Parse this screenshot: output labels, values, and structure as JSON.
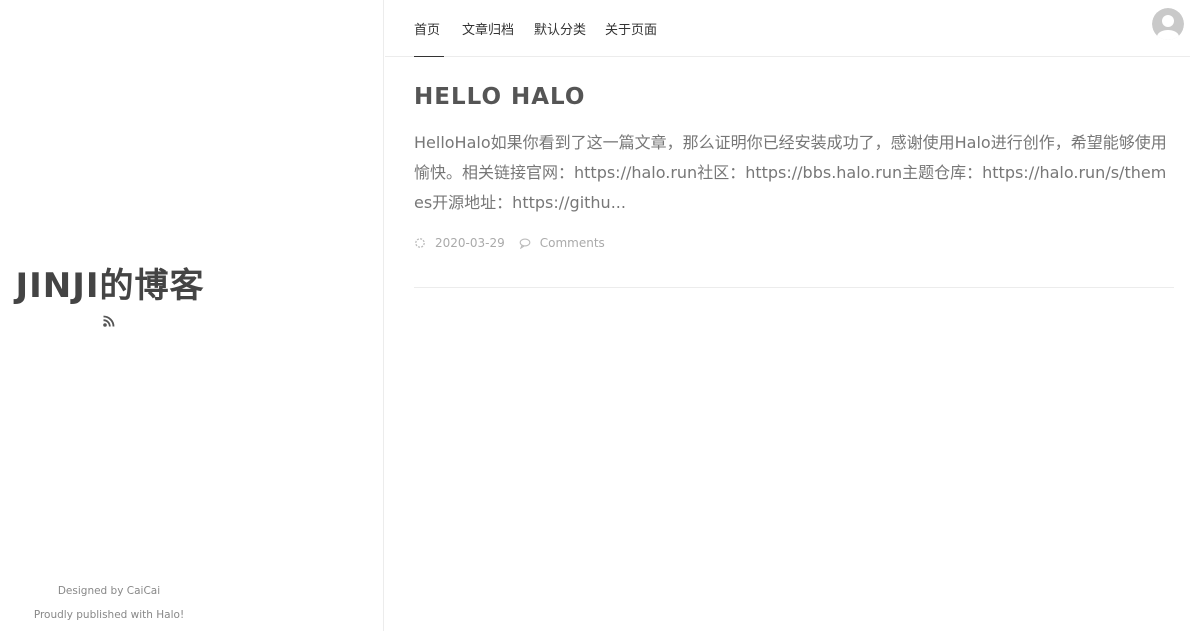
{
  "sidebar": {
    "title": "JINJI的博客",
    "rss_icon": "rss-icon",
    "footer_designed": "Designed by CaiCai",
    "footer_published": "Proudly published with Halo!"
  },
  "nav": {
    "items": [
      {
        "label": "首页",
        "active": true
      },
      {
        "label": "文章归档",
        "active": false
      },
      {
        "label": "默认分类",
        "active": false
      },
      {
        "label": "关于页面",
        "active": false
      }
    ],
    "avatar_icon": "user-avatar-icon"
  },
  "post": {
    "title": "HELLO HALO",
    "excerpt": "HelloHalo如果你看到了这一篇文章，那么证明你已经安装成功了，感谢使用Halo进行创作，希望能够使用愉快。相关链接官网：https://halo.run社区：https://bbs.halo.run主题仓库：https://halo.run/s/themes开源地址：https://githu...",
    "date": "2020-03-29",
    "comments": "Comments"
  },
  "colors": {
    "title": "#444444",
    "text": "#777777",
    "meta": "#aaaaaa",
    "border": "#ececec"
  }
}
